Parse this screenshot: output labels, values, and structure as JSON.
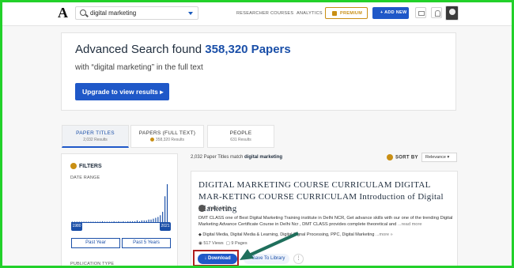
{
  "header": {
    "logo": "A",
    "search_value": "digital marketing",
    "nav": [
      "RESEARCHER",
      "COURSES",
      "ANALYTICS"
    ],
    "premium_label": "PREMIUM",
    "add_new_label": "+ ADD NEW"
  },
  "headline": {
    "prefix": "Advanced Search found ",
    "count": "358,320 Papers",
    "subtitle": "with “digital marketing” in the full text",
    "upgrade_label": "Upgrade to view results ▸"
  },
  "tabs": [
    {
      "title": "PAPER TITLES",
      "sub": "2,032 Results"
    },
    {
      "title": "PAPERS (FULL TEXT)",
      "sub": "358,320 Results"
    },
    {
      "title": "PEOPLE",
      "sub": "631 Results"
    }
  ],
  "filters": {
    "title": "FILTERS",
    "date_range_label": "DATE RANGE",
    "start_year": "1980",
    "end_year": "2021",
    "past_year": "Past Year",
    "past_5_years": "Past 5 Years",
    "publication_type_label": "PUBLICATION TYPE",
    "histogram_values": [
      0,
      0,
      0,
      0,
      0,
      0,
      0,
      0,
      0,
      0,
      0,
      0,
      0,
      1,
      0,
      0,
      0,
      0,
      1,
      0,
      1,
      0,
      1,
      0,
      1,
      1,
      1,
      1,
      2,
      1,
      2,
      2,
      2,
      3,
      3,
      4,
      5,
      6,
      8,
      12,
      30,
      44
    ]
  },
  "results": {
    "match_prefix": "2,032 Paper Titles match ",
    "match_query": "digital marketing",
    "sort_label": "SORT BY",
    "sort_value": "Relevance ▾"
  },
  "paper": {
    "title": "DIGITAL MARKETING COURSE CURRICULAM DIGITAL MAR-KETING COURSE CURRICULAM Introduction of Digital Marketing",
    "author": "mahi singh",
    "snippet": "DMT CLASS one of Best Digital Marketing Training institute in Delhi NCR, Get advance skills with our one of the trending Digital Marketing Advance Certificate Course in Delhi Ncr , DMT CLASS provides complete theoretical and",
    "snippet_more": "...read more",
    "tags": "Digital Media, Digital Media & Learning, Digital Signal Processing, PPC, Digital Marketing",
    "tags_more": "...more »",
    "views": "517 Views",
    "pages": "9 Pages",
    "download_label": "Download",
    "save_label": "+ Save To Library",
    "more_label": "⋮"
  }
}
